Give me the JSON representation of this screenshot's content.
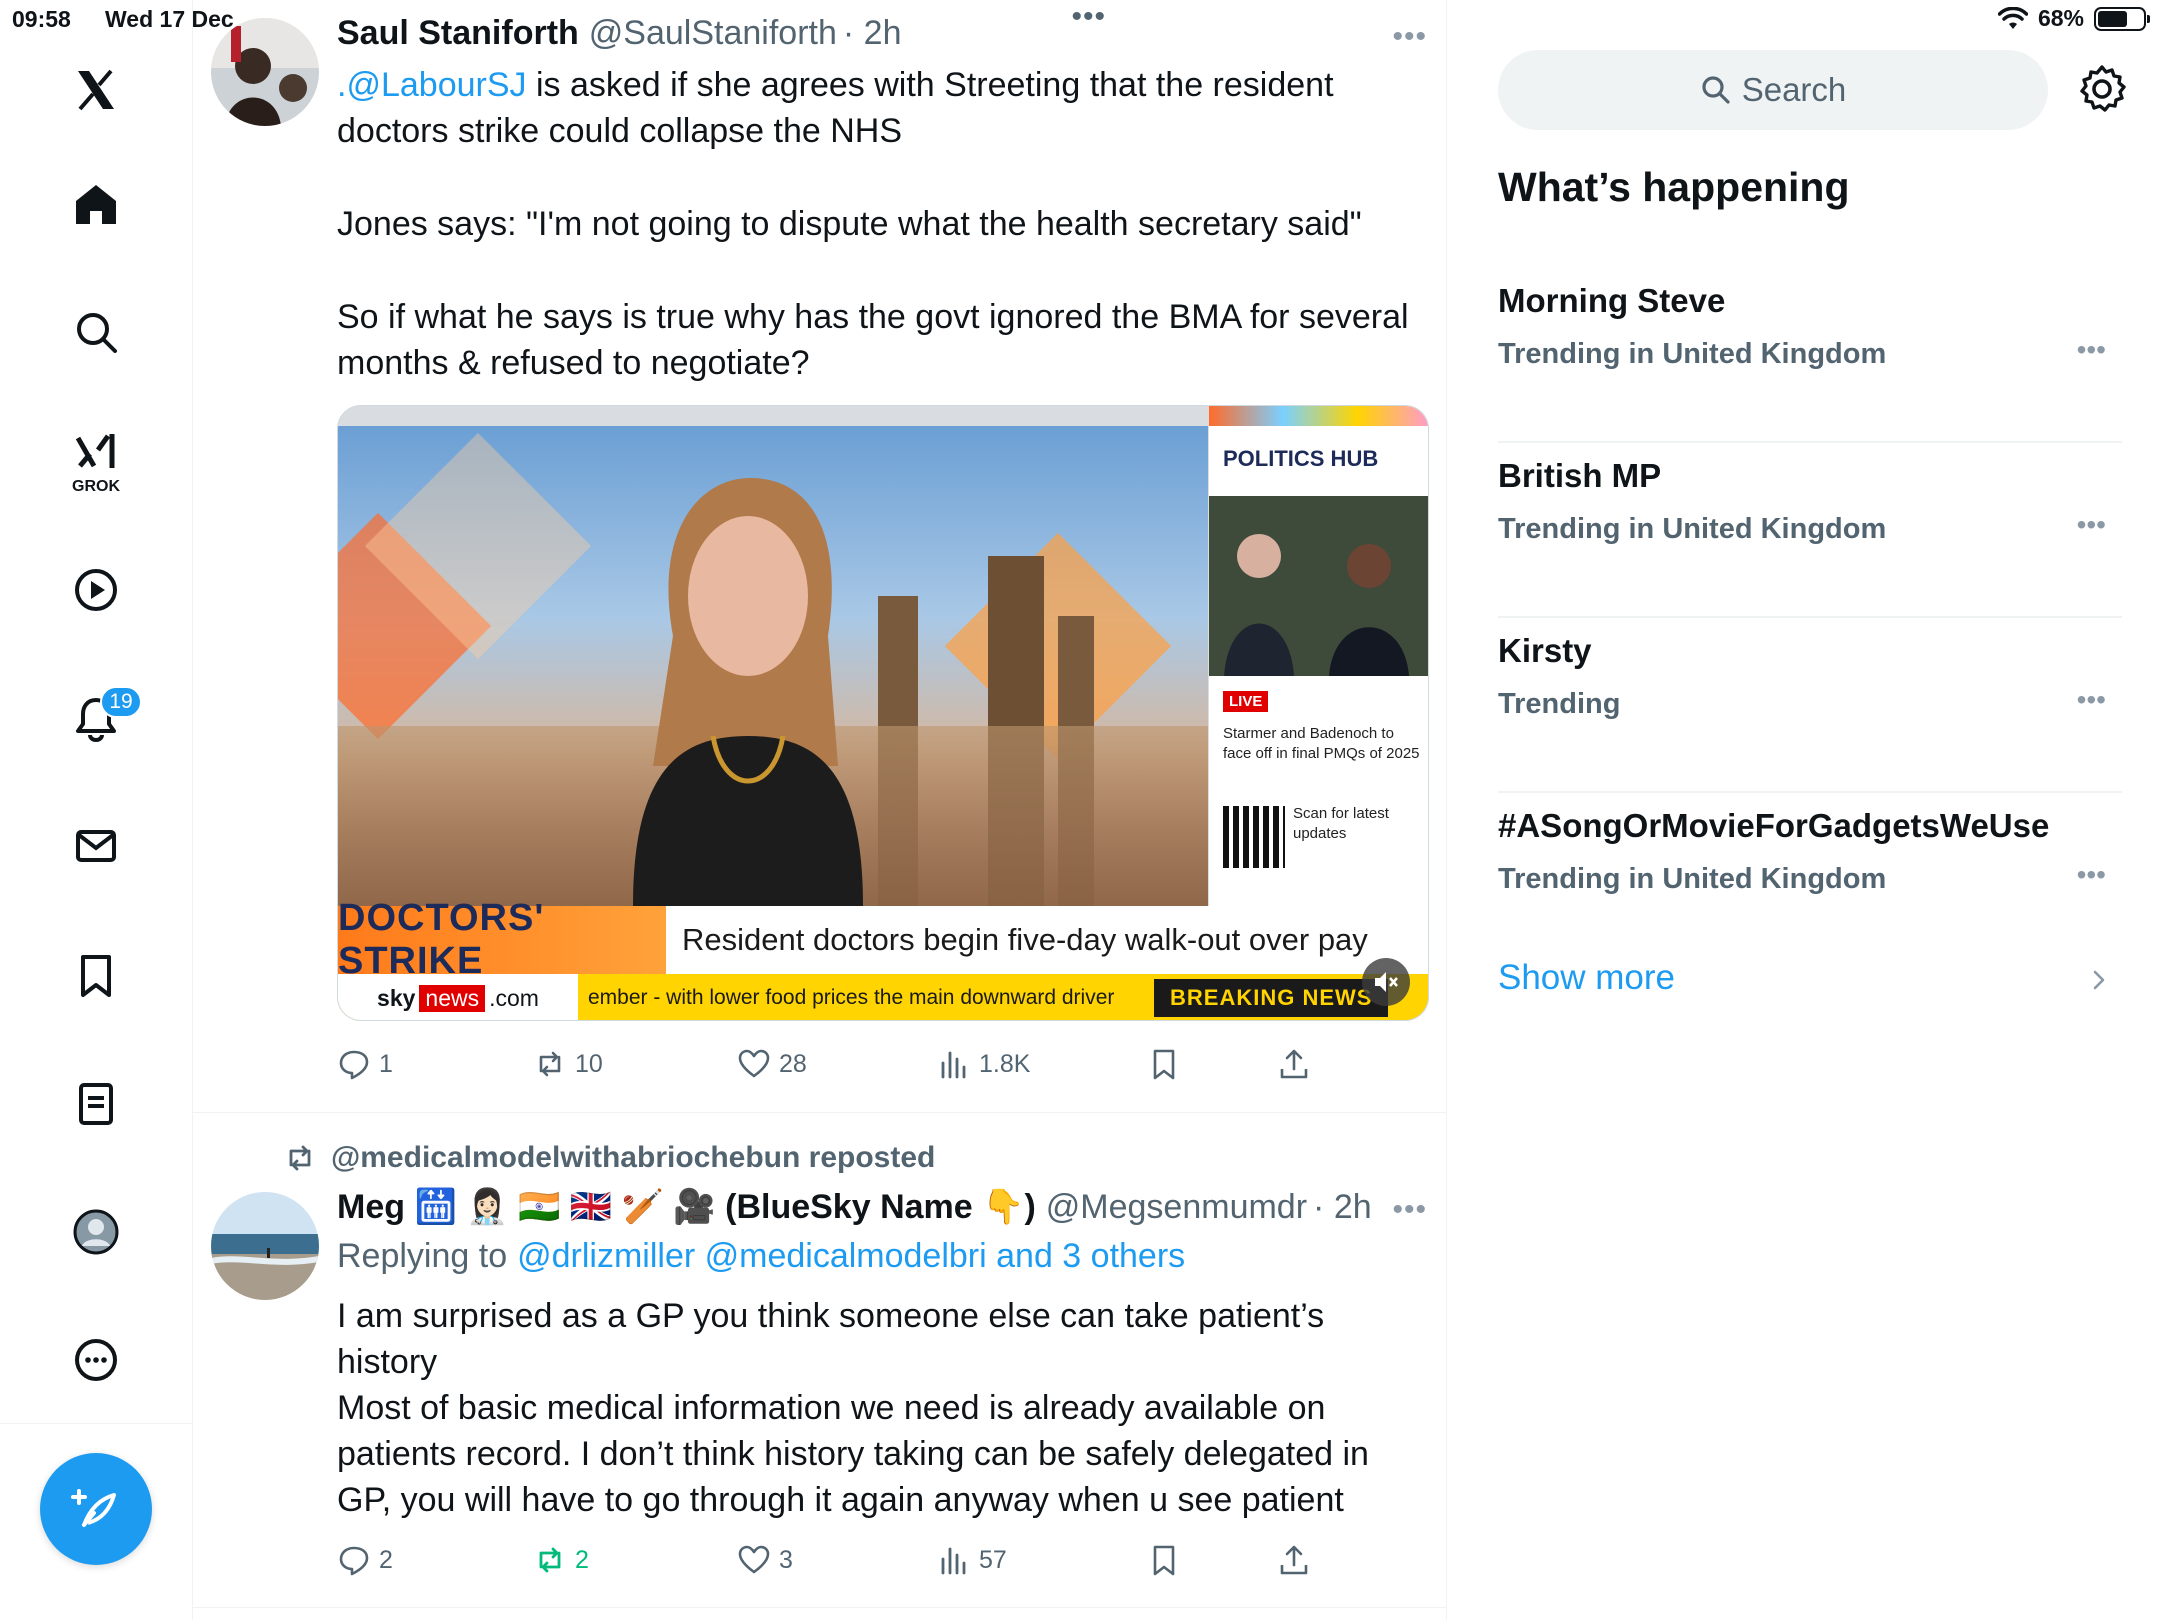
{
  "status_bar": {
    "time": "09:58",
    "date": "Wed 17 Dec",
    "battery": "68%"
  },
  "nav": {
    "grok_label": "GROK",
    "notifications_badge": "19",
    "items": [
      "x-logo",
      "home",
      "explore",
      "grok",
      "videos",
      "notifications",
      "messages",
      "bookmarks",
      "lists",
      "profile",
      "more"
    ]
  },
  "tweets": [
    {
      "name": "Saul Staniforth",
      "handle": "@SaulStaniforth",
      "time": "· 2h",
      "text_mention": ".@LabourSJ",
      "text_p1_rest": " is asked if she agrees with Streeting that the resident doctors strike could collapse the NHS",
      "text_p2": "Jones says: \"I'm not going to dispute what the health secretary said\"",
      "text_p3": "So if what he says is true why has the govt ignored the BMA for several months & refused to negotiate?",
      "media": {
        "hub_title": "POLITICS HUB",
        "live": "LIVE",
        "hub_text": "Starmer and Badenoch to face off in final PMQs of 2025",
        "qr_text": "Scan for latest updates",
        "strike_label": "DOCTORS' STRIKE",
        "headline": "Resident doctors begin five-day walk-out over pay",
        "sky": "sky",
        "sky_news": "news",
        "sky_com": ".com",
        "ticker": "ember - with lower food prices the main downward driver",
        "breaking": "BREAKING NEWS"
      },
      "replies": "1",
      "reposts": "10",
      "likes": "28",
      "views": "1.8K"
    },
    {
      "repost_by": "@medicalmodelwithabriochebun reposted",
      "name": "Meg 🛗 👩🏻‍⚕️ 🇮🇳 🇬🇧 🏏 🎥 (BlueSky Name 👇)",
      "handle": "@Megsenmumdr",
      "time": "· 2h",
      "replying_label": "Replying to",
      "replying_to": "@drlizmiller @medicalmodelbri and 3 others",
      "text": "I am surprised as a GP you think someone else can take patient’s history\nMost of basic medical information we need is already available on patients record. I don’t think history taking can be safely delegated in GP, you will have to go through it again anyway when u see patient",
      "replies": "2",
      "reposts": "2",
      "likes": "3",
      "views": "57"
    }
  ],
  "sidebar": {
    "search_placeholder": "Search",
    "section_title": "What’s happening",
    "trends": [
      {
        "name": "Morning Steve",
        "meta": "Trending in United Kingdom"
      },
      {
        "name": "British MP",
        "meta": "Trending in United Kingdom"
      },
      {
        "name": "Kirsty",
        "meta": "Trending"
      },
      {
        "name": "#ASongOrMovieForGadgetsWeUse",
        "meta": "Trending in United Kingdom"
      }
    ],
    "show_more": "Show more"
  },
  "colors": {
    "accent": "#1d9bf0",
    "repost_active": "#00ba7c",
    "text_secondary": "#536471"
  }
}
